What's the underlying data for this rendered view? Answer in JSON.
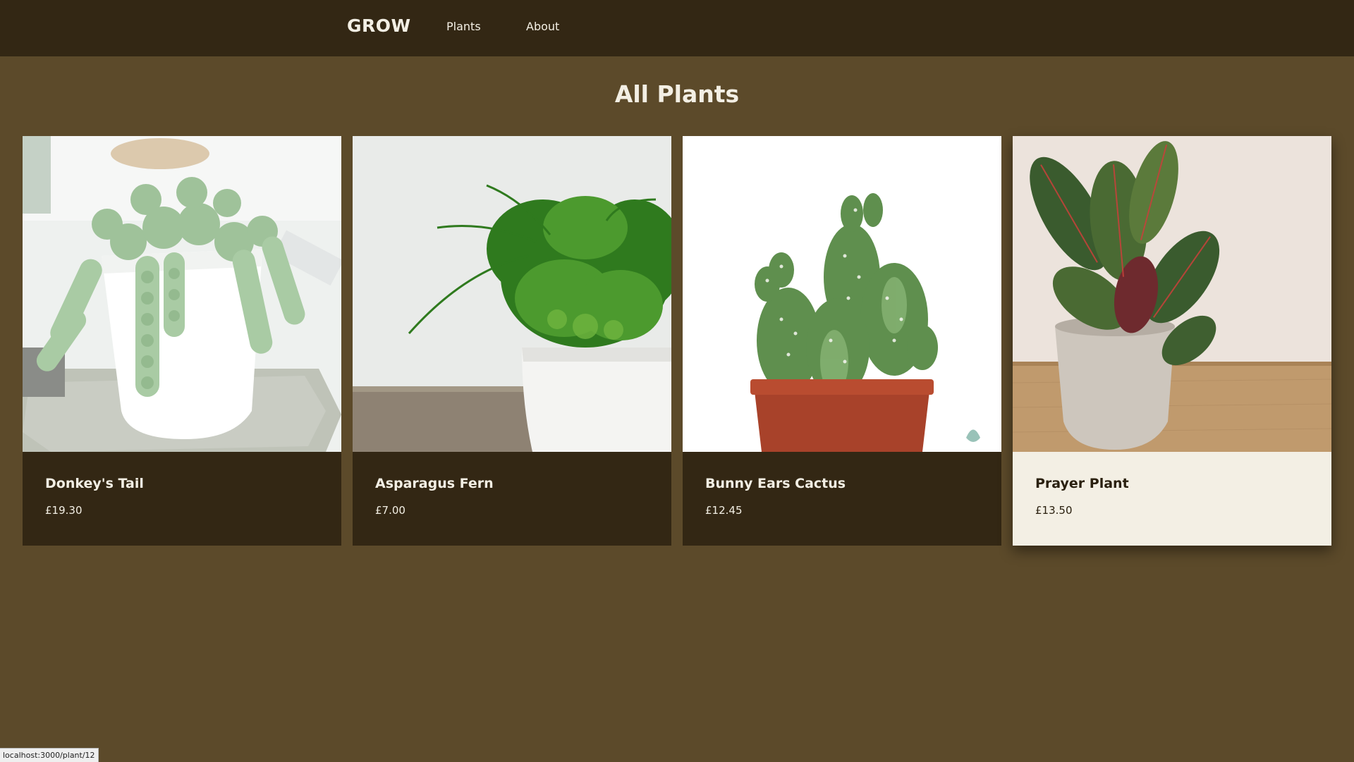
{
  "nav": {
    "brand": "GROW",
    "links": [
      {
        "label": "Plants"
      },
      {
        "label": "About"
      }
    ]
  },
  "page": {
    "title": "All Plants"
  },
  "plants": [
    {
      "name": "Donkey's Tail",
      "price": "£19.30",
      "image": "donkeys-tail-photo"
    },
    {
      "name": "Asparagus Fern",
      "price": "£7.00",
      "image": "asparagus-fern-photo"
    },
    {
      "name": "Bunny Ears Cactus",
      "price": "£12.45",
      "image": "bunny-ears-cactus-photo"
    },
    {
      "name": "Prayer Plant",
      "price": "£13.50",
      "image": "prayer-plant-photo",
      "hovered": true
    }
  ],
  "status_bar": {
    "url": "localhost:3000/plant/12"
  },
  "colors": {
    "nav_background": "#332714",
    "page_background": "#5c4a2a",
    "card_background": "#332714",
    "card_hover_background": "#f3efe4",
    "text_light": "#f3efe4",
    "text_dark": "#2a200f"
  }
}
